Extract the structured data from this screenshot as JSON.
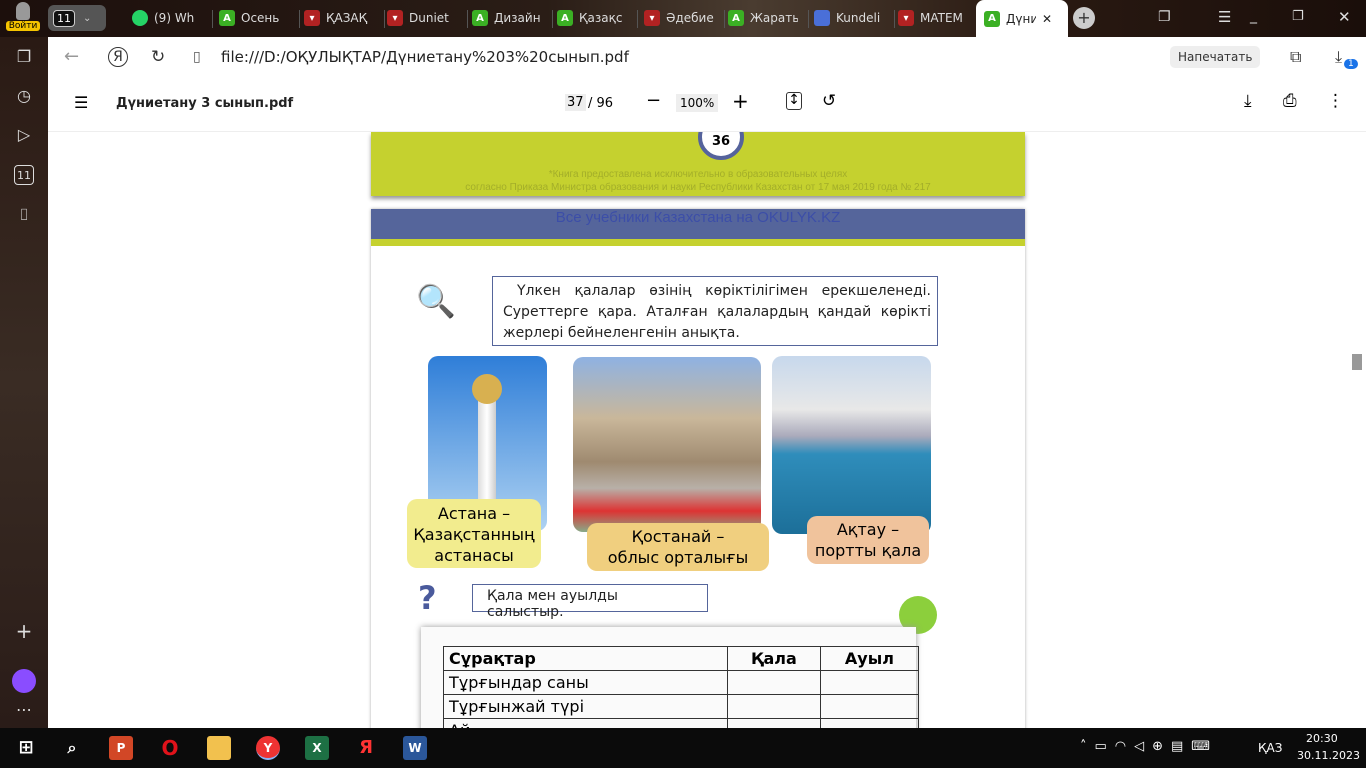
{
  "browser": {
    "login_label": "Войти",
    "tab_count": "11",
    "tabs": [
      {
        "title": "(9) Wh",
        "icon": "whatsapp-icon",
        "color": "#25d366"
      },
      {
        "title": "Осень",
        "icon": "a-icon",
        "color": "#3bb024"
      },
      {
        "title": "ҚАЗАҚ",
        "icon": "pdf-icon",
        "color": "#b22222"
      },
      {
        "title": "Duniet",
        "icon": "pdf-icon",
        "color": "#b22222"
      },
      {
        "title": "Дизайн",
        "icon": "a-icon",
        "color": "#3bb024"
      },
      {
        "title": "Қазақс",
        "icon": "a-icon",
        "color": "#3bb024"
      },
      {
        "title": "Әдебие",
        "icon": "pdf-icon",
        "color": "#b22222"
      },
      {
        "title": "Жарать",
        "icon": "a-icon",
        "color": "#3bb024"
      },
      {
        "title": "Kundeli",
        "icon": "kundelik-icon",
        "color": "#4a6fd8"
      },
      {
        "title": "MATEM",
        "icon": "pdf-icon",
        "color": "#b22222"
      },
      {
        "title": "Дүни",
        "icon": "a-icon",
        "color": "#3bb024"
      }
    ],
    "url": "file:///D:/ОҚУЛЫҚТАР/Дүниетану%203%20сынып.pdf",
    "print_button": "Напечатать",
    "downloads_badge": "1"
  },
  "pdf": {
    "filename": "Дүниетану 3 сынып.pdf",
    "current_page": "37",
    "total_pages": "/ 96",
    "zoom": "100%"
  },
  "page_prev": {
    "page_number": "36",
    "notice_line1": "*Книга предоставлена исключительно в образовательных целях",
    "notice_line2": "согласно Приказа Министра образования и науки Республики Казахстан от 17 мая 2019 года № 217"
  },
  "page": {
    "banner": "Все учебники Казахстана на OKULYK.KZ",
    "task1": "Үлкен қалалар өзінің көріктілігімен ерекшеленеді. Суреттерге қара. Аталған қалалардың қандай көрікті жерлері бейнеленгенін анықта.",
    "captions": [
      "Астана – Қазақстанның астанасы",
      "Қостанай – облыс орталығы",
      "Ақтау – портты қала"
    ],
    "task2": "Қала мен ауылды салыстыр.",
    "table": {
      "headers": [
        "Сұрақтар",
        "Қала",
        "Ауыл"
      ],
      "rows": [
        "Тұрғындар саны",
        "Тұрғынжай түрі",
        "Ай..."
      ]
    }
  },
  "taskbar": {
    "lang": "ҚАЗ",
    "time": "20:30",
    "date": "30.11.2023"
  }
}
